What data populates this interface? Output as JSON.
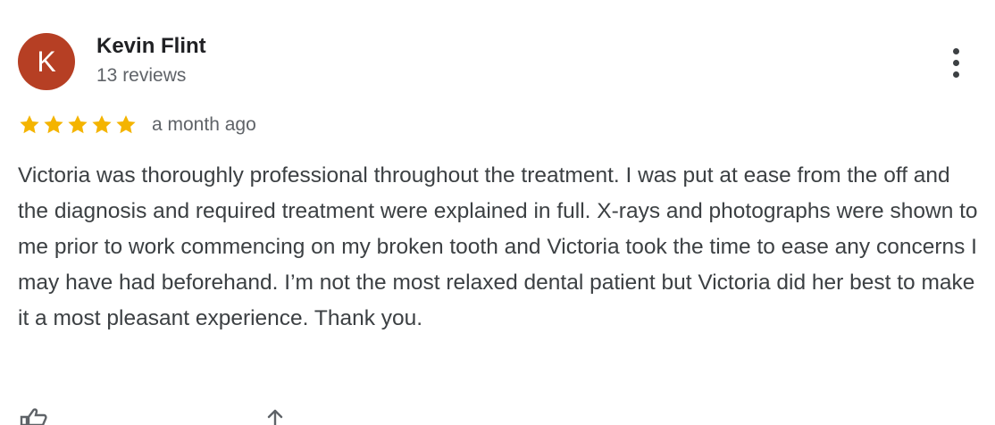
{
  "review": {
    "avatar_initial": "K",
    "avatar_color": "#b63f24",
    "author_name": "Kevin Flint",
    "review_count": "13 reviews",
    "rating": 5,
    "rating_max": 5,
    "star_color": "#f4b400",
    "time_ago": "a month ago",
    "text": "Victoria was thoroughly professional throughout the treatment. I was put at ease from the off and the diagnosis and required treatment were explained in full. X-rays and photographs were shown to me prior to work commencing on my broken tooth and Victoria took the time to ease any concerns I may have had beforehand. I’m not the most relaxed dental patient but Victoria did her best to make it a most pleasant experience. Thank you.",
    "menu_icon": "more-vert-icon",
    "action_icons": [
      "thumbs-up-icon",
      "share-icon"
    ]
  }
}
